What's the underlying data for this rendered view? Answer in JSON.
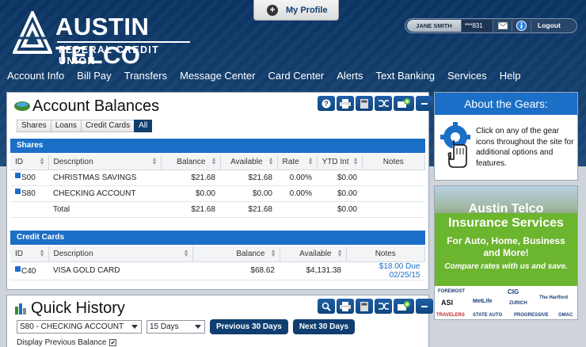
{
  "header": {
    "logo_main": "AUSTIN TELCO",
    "logo_sub": "FEDERAL CREDIT UNION",
    "profile_label": "My Profile",
    "user_name": "JANE SMITH",
    "account_mask": "***831",
    "logout_label": "Logout"
  },
  "nav": [
    "Account Info",
    "Bill Pay",
    "Transfers",
    "Message Center",
    "Card Center",
    "Alerts",
    "Text Banking",
    "Services",
    "Help"
  ],
  "balances": {
    "title": "Account Balances",
    "filters": [
      "Shares",
      "Loans",
      "Credit Cards",
      "All"
    ],
    "active_filter": "All",
    "shares_header": "Shares",
    "shares_columns": [
      "ID",
      "Description",
      "Balance",
      "Available",
      "Rate",
      "YTD Int",
      "Notes"
    ],
    "shares_rows": [
      {
        "id": "S00",
        "desc": "CHRISTMAS SAVINGS",
        "balance": "$21.68",
        "available": "$21.68",
        "rate": "0.00%",
        "ytd": "$0.00",
        "notes": ""
      },
      {
        "id": "S80",
        "desc": "CHECKING ACCOUNT",
        "balance": "$0.00",
        "available": "$0.00",
        "rate": "0.00%",
        "ytd": "$0.00",
        "notes": ""
      }
    ],
    "shares_total": {
      "label": "Total",
      "balance": "$21.68",
      "available": "$21.68",
      "ytd": "$0.00"
    },
    "cards_header": "Credit Cards",
    "cards_columns": [
      "ID",
      "Description",
      "Balance",
      "Available",
      "Notes"
    ],
    "cards_rows": [
      {
        "id": "C40",
        "desc": "VISA GOLD CARD",
        "balance": "$68.62",
        "available": "$4,131.38",
        "notes": "$18.00 Due 02/25/15"
      }
    ]
  },
  "gears": {
    "title": "About the Gears:",
    "text": "Click on any of the gear icons throughout the site for additional options and features."
  },
  "insurance": {
    "line1": "Austin Telco",
    "line2": "Insurance Services",
    "line3": "For Auto, Home, Business",
    "line4": "and More!",
    "line5": "Compare rates with us and save.",
    "brands": [
      "FOREMOST",
      "CIG",
      "ASI",
      "MetLife",
      "ZURICH",
      "The Hartford",
      "TRAVELERS",
      "STATE AUTO",
      "PROGRESSIVE",
      "GMAC"
    ]
  },
  "quick_history": {
    "title": "Quick History",
    "account_select": "S80 - CHECKING ACCOUNT",
    "days_select": "15 Days",
    "prev_button": "Previous 30 Days",
    "next_button": "Next 30 Days",
    "display_prev_label": "Display Previous Balance",
    "display_prev_checked": "✔"
  },
  "colors": {
    "header_blue": "#0b3564",
    "section_blue": "#1b6fc7",
    "button_navy": "#0e3f70",
    "insurance_green": "#6cb52f"
  }
}
